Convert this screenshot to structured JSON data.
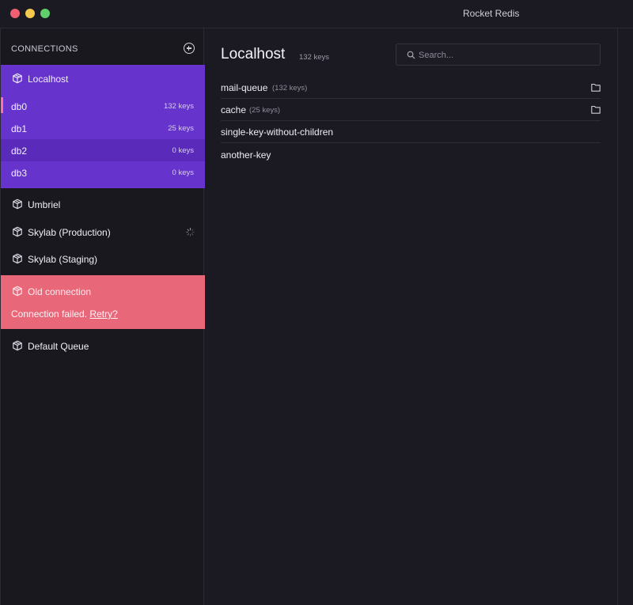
{
  "window": {
    "title": "Rocket Redis"
  },
  "sidebar": {
    "title": "CONNECTIONS",
    "active_connection": {
      "label": "Localhost",
      "databases": [
        {
          "name": "db0",
          "keys": "132 keys"
        },
        {
          "name": "db1",
          "keys": "25 keys"
        },
        {
          "name": "db2",
          "keys": "0 keys"
        },
        {
          "name": "db3",
          "keys": "0 keys"
        }
      ]
    },
    "connections": [
      {
        "label": "Umbriel"
      },
      {
        "label": "Skylab (Production)"
      },
      {
        "label": "Skylab (Staging)"
      }
    ],
    "failed_connection": {
      "label": "Old connection",
      "message": "Connection failed.",
      "retry": "Retry?"
    },
    "other_connections": [
      {
        "label": "Default Queue"
      }
    ]
  },
  "main": {
    "title": "Localhost",
    "count": "132 keys",
    "search": {
      "placeholder": "Search..."
    },
    "keys": [
      {
        "name": "mail-queue",
        "count": "(132 keys)",
        "icon": "folder-icon"
      },
      {
        "name": "cache",
        "count": "(25 keys)",
        "icon": "folder-icon"
      },
      {
        "name": "single-key-without-children"
      },
      {
        "name": "another-key"
      }
    ]
  },
  "colors": {
    "accent": "#6633cc",
    "error": "#e8687a",
    "selection_marker": "#ff6fb0",
    "background": "#1b1a22"
  }
}
